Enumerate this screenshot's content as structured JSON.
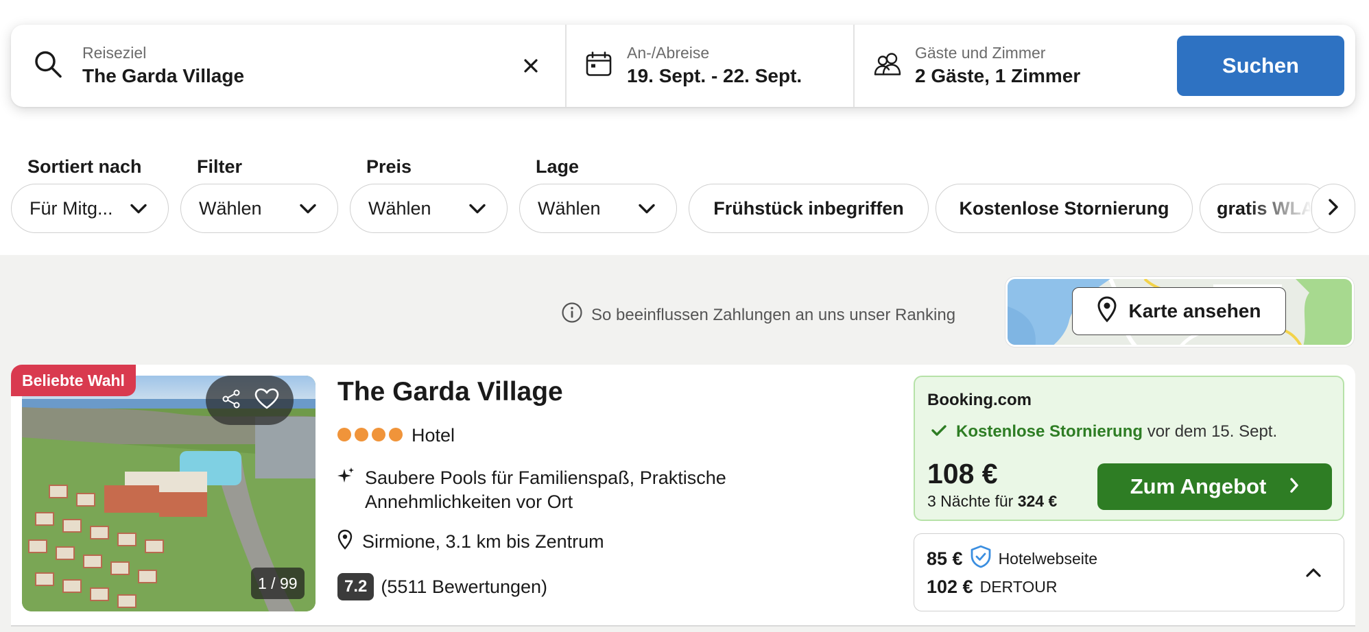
{
  "search": {
    "destination_label": "Reiseziel",
    "destination_value": "The Garda Village",
    "dates_label": "An-/Abreise",
    "dates_value": "19. Sept. - 22. Sept.",
    "guests_label": "Gäste und Zimmer",
    "guests_value": "2 Gäste, 1 Zimmer",
    "search_button": "Suchen"
  },
  "filters": {
    "sort_label": "Sortiert nach",
    "sort_value": "Für Mitg...",
    "filter_label": "Filter",
    "filter_value": "Wählen",
    "price_label": "Preis",
    "price_value": "Wählen",
    "location_label": "Lage",
    "location_value": "Wählen",
    "tags": [
      "Frühstück inbegriffen",
      "Kostenlose Stornierung",
      "gratis WLAN"
    ]
  },
  "ranking_info": "So beeinflussen Zahlungen an uns unser Ranking",
  "map_button": "Karte ansehen",
  "hotel": {
    "badge": "Beliebte Wahl",
    "name": "The Garda Village",
    "stars": 4,
    "type": "Hotel",
    "features_line1": "Saubere Pools für Familienspaß, Praktische",
    "features_line2": "Annehmlichkeiten vor Ort",
    "location": "Sirmione, 3.1 km bis Zentrum",
    "rating_score": "7.2",
    "rating_count": "(5511 Bewertungen)",
    "photo_count": "1 / 99",
    "main_offer": {
      "provider": "Booking.com",
      "cancel_strong": "Kostenlose Stornierung",
      "cancel_rest": "vor dem 15. Sept.",
      "price": "108 €",
      "nights_text": "3 Nächte für",
      "nights_total": "324 €",
      "button": "Zum Angebot"
    },
    "alt_offers": [
      {
        "price": "85 €",
        "provider": "Hotelwebseite"
      },
      {
        "price": "102 €",
        "provider": "DERTOUR"
      }
    ]
  },
  "colors": {
    "primary_blue": "#2e72c2",
    "deal_green": "#2e7d24",
    "badge_red": "#d93a4f",
    "star_orange": "#f0943a"
  }
}
